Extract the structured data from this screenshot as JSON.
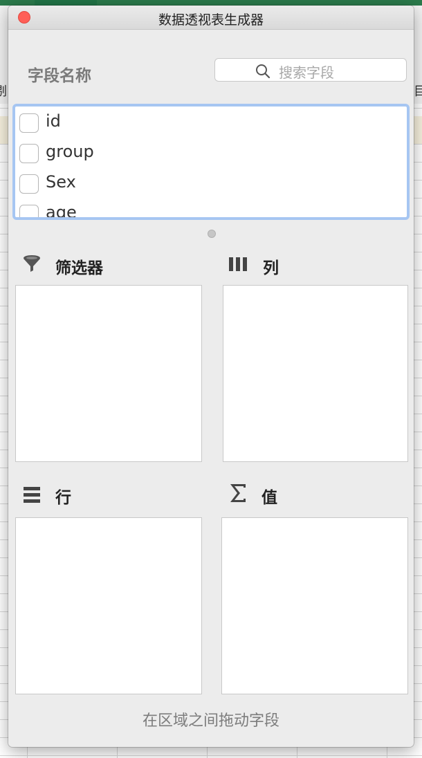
{
  "window": {
    "title": "数据透视表生成器"
  },
  "field_section": {
    "header": "字段名称",
    "search_placeholder": "搜索字段",
    "fields": [
      "id",
      "group",
      "Sex",
      "age"
    ]
  },
  "areas": {
    "filter": {
      "label": "筛选器",
      "icon": "funnel-icon"
    },
    "columns": {
      "label": "列",
      "icon": "columns-icon"
    },
    "rows": {
      "label": "行",
      "icon": "rows-icon"
    },
    "values": {
      "label": "值",
      "icon": "sigma-icon"
    }
  },
  "footer": {
    "hint": "在区域之间拖动字段"
  },
  "background": {
    "left_partial_char": "剔",
    "right_partial_char": "目"
  },
  "colors": {
    "close_button": "#ff5f57",
    "list_focus_border": "#a6c6f2",
    "ribbon_green": "#217346"
  }
}
